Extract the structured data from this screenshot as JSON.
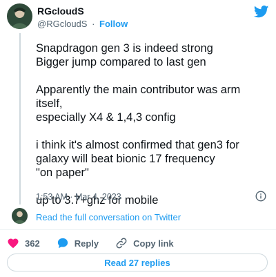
{
  "author": {
    "display_name": "RGcloudS",
    "handle": "@RGcloudS",
    "separator": "·",
    "follow_label": "Follow"
  },
  "tweet": {
    "lines": {
      "l1": "Snapdragon gen 3 is indeed strong",
      "l2": "Bigger jump compared to last gen",
      "l3": "Apparently the main contributor was arm itself,",
      "l4": "especially X4 & 1,4,3 config",
      "l5": "i think it's almost confirmed that gen3 for",
      "l6": "galaxy will beat bionic 17 frequency",
      "l7": "\"on paper\"",
      "l8": "up to 3.7+ghz for mobile"
    },
    "timestamp": "1:53 AM · Mar 4, 2023"
  },
  "conversation": {
    "link_label": "Read the full conversation on Twitter"
  },
  "actions": {
    "like_count": "362",
    "reply_label": "Reply",
    "copy_link_label": "Copy link"
  },
  "replies": {
    "button_label": "Read 27 replies"
  },
  "icons": {
    "brand": "twitter-bird-icon",
    "info": "info-icon",
    "like": "heart-icon",
    "reply": "speech-bubble-icon",
    "copy_link": "link-icon"
  },
  "colors": {
    "brand": "#1d9bf0",
    "like": "#f91880",
    "text": "#0f1419",
    "muted": "#536471"
  }
}
